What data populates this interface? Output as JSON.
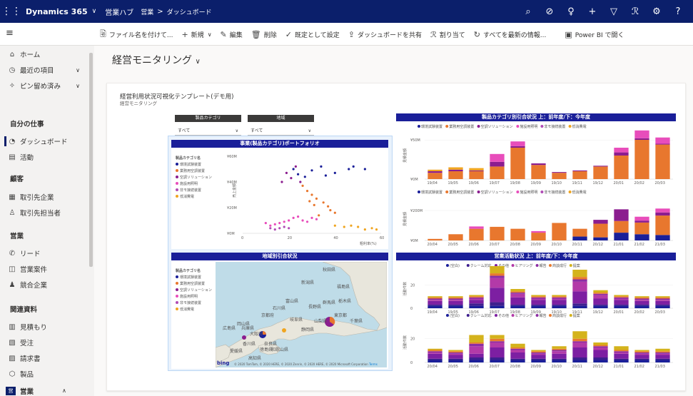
{
  "topbar": {
    "app_name": "Dynamics 365",
    "hub": "営業ハブ",
    "crumb_area": "営業",
    "crumb_sep": ">",
    "crumb_page": "ダッシュボード",
    "icons": [
      "search-icon",
      "target-icon",
      "lightbulb-icon",
      "plus-icon",
      "filter-icon",
      "person-assist-icon",
      "gear-icon",
      "help-icon"
    ]
  },
  "commandbar": {
    "save_as": "ファイル名を付けて...",
    "new": "新規",
    "edit": "編集",
    "delete": "削除",
    "set_default": "既定として設定",
    "share": "ダッシュボードを共有",
    "assign": "割り当て",
    "refresh": "すべてを最新の情報...",
    "powerbi": "Power BI で開く"
  },
  "sidebar": {
    "home": "ホーム",
    "recent": "最近の項目",
    "pinned": "ピン留め済み",
    "sections": {
      "mywork": "自分の仕事",
      "customers": "顧客",
      "sales": "営業",
      "collateral": "関連資料"
    },
    "items": {
      "dashboard": "ダッシュボード",
      "activities": "活動",
      "accounts": "取引先企業",
      "contacts": "取引先担当者",
      "leads": "リード",
      "opportunities": "営業案件",
      "competitors": "競合企業",
      "quotes": "見積もり",
      "orders": "受注",
      "invoices": "請求書",
      "products": "製品"
    },
    "area_badge": "営",
    "area_name": "営業"
  },
  "page": {
    "title": "経営モニタリング",
    "report_title": "経営利用状況可視化テンプレート(デモ用)",
    "report_subtitle": "経営モニタリング"
  },
  "slicers": {
    "category_label": "製品カテゴリ",
    "category_value": "すべて",
    "region_label": "地域",
    "region_value": "すべて"
  },
  "legend": {
    "title": "製品カテゴリ名",
    "items": [
      "環境試験装置",
      "業務用空調装置",
      "空調ソリューション",
      "施設用照明",
      "非モ接続装置",
      "低消費電"
    ],
    "colors": [
      "#1a1f99",
      "#e8772e",
      "#8b1d8f",
      "#e84dbb",
      "#b04bb5",
      "#f0a520"
    ]
  },
  "activity_legend": {
    "items": [
      "(空白)",
      "クレーム対応",
      "その他",
      "ヒアリング",
      "報告",
      "商談成行",
      "提案"
    ],
    "colors": [
      "#1a1f99",
      "#3e1f8e",
      "#7d1fa2",
      "#b33aa8",
      "#8c2ea3",
      "#e87b2e",
      "#d4b31c"
    ]
  },
  "scatter_panel": {
    "title": "事業(製品カテゴリ)ポートフォリオ",
    "ylabel": "売上金額",
    "xlabel": "粗利率(%)"
  },
  "bar_panel": {
    "title": "製品カテゴリ別引合状況 上：前年度/下：今年度",
    "ylabel": "見積金額"
  },
  "map_panel": {
    "title": "地域別引合状況",
    "attribution": "© 2020 TomTom, © 2020 HERE, © 2020 Zenrin, © 2020 HERE, © 2020 Microsoft Corporation",
    "terms": "Terms",
    "logo": "bing"
  },
  "activity_panel": {
    "title": "営業活動状況 上：前年度/下：今年度",
    "ylabel": "活動件数"
  },
  "map_labels": [
    "秋田県",
    "新潟県",
    "福島県",
    "富山県",
    "長野県",
    "群馬県",
    "栃木県",
    "石川県",
    "岐阜県",
    "静岡県",
    "山梨県",
    "東京都",
    "千葉県",
    "兵庫県",
    "京都府",
    "大阪府",
    "奈良県",
    "広島県",
    "岡山県",
    "香川県",
    "徳島県",
    "愛媛県",
    "高知県",
    "和歌山県"
  ],
  "chart_data": [
    {
      "type": "scatter",
      "title": "事業(製品カテゴリ)ポートフォリオ",
      "xlabel": "粗利率(%)",
      "ylabel": "売上金額",
      "xlim": [
        0,
        60
      ],
      "ylim": [
        0,
        60
      ],
      "x_ticks": [
        "0",
        "20",
        "40",
        "60"
      ],
      "y_ticks": [
        "¥0M",
        "¥20M",
        "¥40M",
        "¥60M"
      ],
      "series": [
        {
          "name": "環境試験装置",
          "points": [
            [
              22,
              50
            ],
            [
              24,
              46
            ],
            [
              30,
              49
            ],
            [
              34,
              52
            ],
            [
              40,
              47
            ],
            [
              46,
              50
            ],
            [
              48,
              52
            ],
            [
              53,
              50
            ],
            [
              27,
              44
            ],
            [
              36,
              45
            ]
          ]
        },
        {
          "name": "業務用空調装置",
          "points": [
            [
              26,
              37
            ],
            [
              28,
              33
            ],
            [
              30,
              30
            ],
            [
              32,
              27
            ],
            [
              35,
              24
            ],
            [
              37,
              21
            ],
            [
              29,
              25
            ],
            [
              31,
              22
            ],
            [
              38,
              18
            ],
            [
              40,
              16
            ],
            [
              33,
              14
            ]
          ]
        },
        {
          "name": "空調ソリューション",
          "points": [
            [
              19,
              47
            ],
            [
              21,
              43
            ],
            [
              17,
              40
            ],
            [
              23,
              52
            ],
            [
              25,
              40
            ]
          ]
        },
        {
          "name": "施設用照明",
          "points": [
            [
              10,
              8
            ],
            [
              12,
              6
            ],
            [
              14,
              7
            ],
            [
              16,
              8
            ],
            [
              18,
              9
            ],
            [
              20,
              10
            ],
            [
              22,
              12
            ],
            [
              24,
              13
            ],
            [
              26,
              10
            ],
            [
              28,
              9
            ],
            [
              30,
              12
            ],
            [
              32,
              11
            ]
          ]
        },
        {
          "name": "非モ接続装置",
          "points": [
            [
              12,
              4
            ],
            [
              14,
              3
            ],
            [
              16,
              4
            ],
            [
              18,
              5
            ],
            [
              20,
              4
            ]
          ]
        },
        {
          "name": "低消費電",
          "points": [
            [
              40,
              6
            ],
            [
              44,
              5
            ],
            [
              47,
              6
            ],
            [
              50,
              5
            ],
            [
              53,
              3
            ],
            [
              56,
              4
            ],
            [
              58,
              3
            ]
          ]
        }
      ]
    },
    {
      "type": "bar",
      "title": "製品カテゴリ別引合状況 上：前年度",
      "ylabel": "見積金額",
      "y_ticks": [
        "¥0M",
        "¥50M"
      ],
      "categories": [
        "19/04",
        "19/05",
        "19/06",
        "19/07",
        "19/08",
        "19/09",
        "19/10",
        "19/11",
        "19/12",
        "20/01",
        "20/02",
        "20/03"
      ],
      "series": [
        {
          "name": "環境試験装置",
          "values": [
            0,
            0,
            0,
            0,
            0,
            0,
            0,
            0,
            0,
            0,
            0,
            0
          ]
        },
        {
          "name": "業務用空調装置",
          "values": [
            8,
            10,
            10,
            16,
            40,
            18,
            8,
            10,
            16,
            30,
            50,
            44
          ]
        },
        {
          "name": "空調ソリューション",
          "values": [
            2,
            2,
            1,
            6,
            2,
            2,
            1,
            1,
            1,
            4,
            2,
            1
          ]
        },
        {
          "name": "施設用照明",
          "values": [
            0,
            0,
            0,
            10,
            6,
            0,
            0,
            0,
            0,
            6,
            10,
            8
          ]
        },
        {
          "name": "非モ接続装置",
          "values": [
            0,
            0,
            0,
            0,
            0,
            0,
            0,
            0,
            0,
            0,
            0,
            0
          ]
        },
        {
          "name": "低消費電",
          "values": [
            2,
            3,
            3,
            0,
            0,
            0,
            0,
            0,
            0,
            0,
            0,
            0
          ]
        }
      ]
    },
    {
      "type": "bar",
      "title": "製品カテゴリ別引合状況 下：今年度",
      "ylabel": "見積金額",
      "y_ticks": [
        "¥0M",
        "¥200M"
      ],
      "categories": [
        "20/04",
        "20/05",
        "20/06",
        "20/07",
        "20/08",
        "20/09",
        "20/10",
        "20/11",
        "20/12",
        "21/01",
        "21/02",
        "21/03"
      ],
      "series": [
        {
          "name": "環境試験装置",
          "values": [
            0,
            0,
            0,
            0,
            0,
            0,
            0,
            10,
            8,
            20,
            16,
            14
          ]
        },
        {
          "name": "業務用空調装置",
          "values": [
            4,
            16,
            30,
            35,
            30,
            20,
            45,
            20,
            35,
            30,
            30,
            50
          ]
        },
        {
          "name": "空調ソリューション",
          "values": [
            0,
            0,
            0,
            0,
            0,
            0,
            0,
            0,
            10,
            30,
            5,
            8
          ]
        },
        {
          "name": "施設用照明",
          "values": [
            0,
            0,
            6,
            0,
            0,
            4,
            0,
            0,
            0,
            0,
            10,
            10
          ]
        },
        {
          "name": "非モ接続装置",
          "values": [
            0,
            0,
            0,
            0,
            0,
            0,
            0,
            0,
            0,
            0,
            0,
            0
          ]
        },
        {
          "name": "低消費電",
          "values": [
            0,
            0,
            0,
            0,
            0,
            0,
            0,
            0,
            0,
            0,
            0,
            0
          ]
        }
      ]
    },
    {
      "type": "bar",
      "title": "営業活動状況 上：前年度",
      "ylabel": "活動件数",
      "y_ticks": [
        "0",
        "20"
      ],
      "categories": [
        "19/04",
        "19/05",
        "19/06",
        "19/07",
        "19/08",
        "19/09",
        "19/10",
        "19/11",
        "19/12",
        "20/01",
        "20/02",
        "20/03"
      ],
      "series": [
        {
          "name": "(空白)",
          "values": [
            2,
            2,
            2,
            2,
            2,
            2,
            2,
            2,
            2,
            2,
            2,
            2
          ]
        },
        {
          "name": "クレーム対応",
          "values": [
            1,
            1,
            2,
            3,
            1,
            1,
            1,
            2,
            1,
            1,
            1,
            1
          ]
        },
        {
          "name": "その他",
          "values": [
            3,
            3,
            3,
            12,
            6,
            4,
            4,
            10,
            5,
            4,
            3,
            3
          ]
        },
        {
          "name": "ヒアリング",
          "values": [
            1,
            1,
            1,
            8,
            3,
            1,
            1,
            8,
            3,
            1,
            1,
            1
          ]
        },
        {
          "name": "報告",
          "values": [
            1,
            1,
            1,
            2,
            1,
            1,
            1,
            2,
            1,
            1,
            1,
            1
          ]
        },
        {
          "name": "商談成行",
          "values": [
            1,
            1,
            1,
            2,
            1,
            1,
            1,
            2,
            1,
            1,
            1,
            1
          ]
        },
        {
          "name": "提案",
          "values": [
            1,
            1,
            1,
            6,
            2,
            1,
            1,
            6,
            2,
            1,
            1,
            1
          ]
        }
      ]
    },
    {
      "type": "bar",
      "title": "営業活動状況 下：今年度",
      "ylabel": "活動件数",
      "y_ticks": [
        "0",
        "20"
      ],
      "categories": [
        "20/04",
        "20/05",
        "20/06",
        "20/07",
        "20/08",
        "20/09",
        "20/10",
        "20/11",
        "20/12",
        "21/01",
        "21/02",
        "21/03"
      ],
      "series": [
        {
          "name": "(空白)",
          "values": [
            2,
            2,
            2,
            2,
            2,
            2,
            2,
            2,
            2,
            2,
            2,
            2
          ]
        },
        {
          "name": "クレーム対応",
          "values": [
            1,
            1,
            2,
            2,
            1,
            1,
            1,
            2,
            2,
            1,
            1,
            1
          ]
        },
        {
          "name": "その他",
          "values": [
            4,
            3,
            3,
            8,
            5,
            3,
            4,
            8,
            6,
            4,
            3,
            3
          ]
        },
        {
          "name": "ヒアリング",
          "values": [
            1,
            1,
            6,
            4,
            2,
            1,
            2,
            4,
            2,
            1,
            1,
            1
          ]
        },
        {
          "name": "報告",
          "values": [
            1,
            1,
            2,
            1,
            1,
            1,
            1,
            1,
            1,
            1,
            1,
            1
          ]
        },
        {
          "name": "商談成行",
          "values": [
            1,
            1,
            1,
            2,
            1,
            1,
            1,
            2,
            1,
            1,
            1,
            1
          ]
        },
        {
          "name": "提案",
          "values": [
            1,
            1,
            6,
            3,
            3,
            1,
            2,
            6,
            2,
            3,
            1,
            2
          ]
        }
      ]
    }
  ]
}
